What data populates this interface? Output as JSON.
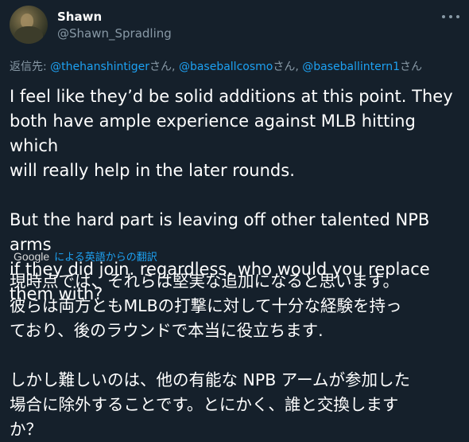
{
  "author": {
    "name": "Shawn",
    "handle": "@Shawn_Spradling"
  },
  "reply": {
    "prefix": "返信先: ",
    "mentions": [
      {
        "handle": "@thehanshintiger",
        "suffix": "さん, "
      },
      {
        "handle": "@baseballcosmo",
        "suffix": "さん, "
      },
      {
        "handle": "@baseballintern1",
        "suffix": "さん"
      }
    ]
  },
  "tweet": {
    "text": "I feel like they’d be solid additions at this point. They\nboth have ample experience against MLB hitting which\nwill really help in the later rounds.\n\nBut the hard part is leaving off other talented NPB arms\nif they did join. regardless, who would you replace\nthem with?"
  },
  "translation": {
    "provider": "Google",
    "link_label": "による英語からの翻訳",
    "text": "現時点では、それらは堅実な追加になると思います。\n彼らは両方ともMLBの打撃に対して十分な経験を持っ\nており、後のラウンドで本当に役立ちます.\n\nしかし難しいのは、他の有能な NPB アームが参加した\n場合に除外することです。とにかく、誰と交換します\nか？"
  },
  "colors": {
    "background": "#15202b",
    "link": "#1da1f2",
    "secondary_text": "#8899a6"
  },
  "icons": {
    "more": "more-dots-icon"
  }
}
